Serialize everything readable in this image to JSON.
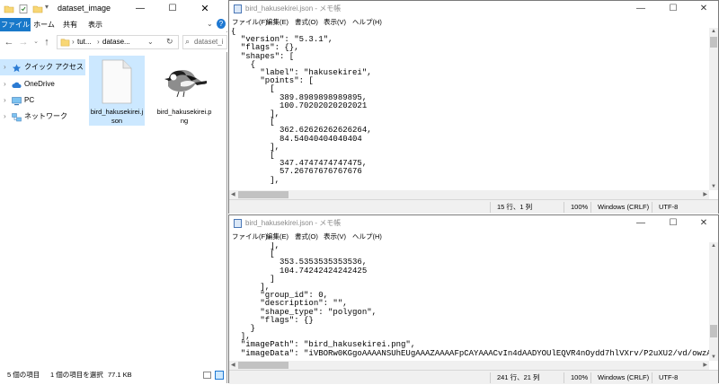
{
  "explorer": {
    "window_title": "dataset_image",
    "ribbon_tabs": [
      "ファイル",
      "ホーム",
      "共有",
      "表示"
    ],
    "address": {
      "crumb1": "tut...",
      "crumb2": "datase..."
    },
    "search_placeholder": "dataset_i",
    "nav_items": [
      {
        "label": "クイック アクセス",
        "icon": "star-icon"
      },
      {
        "label": "OneDrive",
        "icon": "cloud-icon"
      },
      {
        "label": "PC",
        "icon": "pc-icon"
      },
      {
        "label": "ネットワーク",
        "icon": "network-icon"
      }
    ],
    "files": [
      {
        "name": "bird_hakusekirei.json",
        "icon": "document-icon"
      },
      {
        "name": "bird_hakusekirei.png",
        "icon": "bird-image-thumbnail"
      }
    ],
    "status": {
      "count": "5 個の項目",
      "selected": "1 個の項目を選択",
      "size": "77.1 KB"
    }
  },
  "notepad_top": {
    "title": "bird_hakusekirei.json - メモ帳",
    "menu": [
      "ファイル(F)",
      "編集(E)",
      "書式(O)",
      "表示(V)",
      "ヘルプ(H)"
    ],
    "content": "{\n  \"version\": \"5.3.1\",\n  \"flags\": {},\n  \"shapes\": [\n    {\n      \"label\": \"hakusekirei\",\n      \"points\": [\n        [\n          389.8989898989895,\n          100.70202020202021\n        ],\n        [\n          362.62626262626264,\n          84.54040404040404\n        ],\n        [\n          347.4747474747475,\n          57.26767676767676\n        ],",
    "status": {
      "position": "15 行、1 列",
      "zoom": "100%",
      "eol": "Windows (CRLF)",
      "encoding": "UTF-8"
    }
  },
  "notepad_bottom": {
    "title": "bird_hakusekirei.json - メモ帳",
    "menu": [
      "ファイル(F)",
      "編集(E)",
      "書式(O)",
      "表示(V)",
      "ヘルプ(H)"
    ],
    "content": "        ],\n        [\n          353.5353535353536,\n          104.74242424242425\n        ]\n      ],\n      \"group_id\": 0,\n      \"description\": \"\",\n      \"shape_type\": \"polygon\",\n      \"flags\": {}\n    }\n  ],\n  \"imagePath\": \"bird_hakusekirei.png\",\n  \"imageData\": \"iVBORw0KGgoAAAANSUhEUgAAAZAAAAFpCAYAAACvIn4dAADYOUlEQVR4nOydd7hlVXrv/P2uXU2/vd/owzAwMQ+8dQUBExRJ7i9",
    "status": {
      "position": "241 行、21 列",
      "zoom": "100%",
      "eol": "Windows (CRLF)",
      "encoding": "UTF-8"
    }
  }
}
